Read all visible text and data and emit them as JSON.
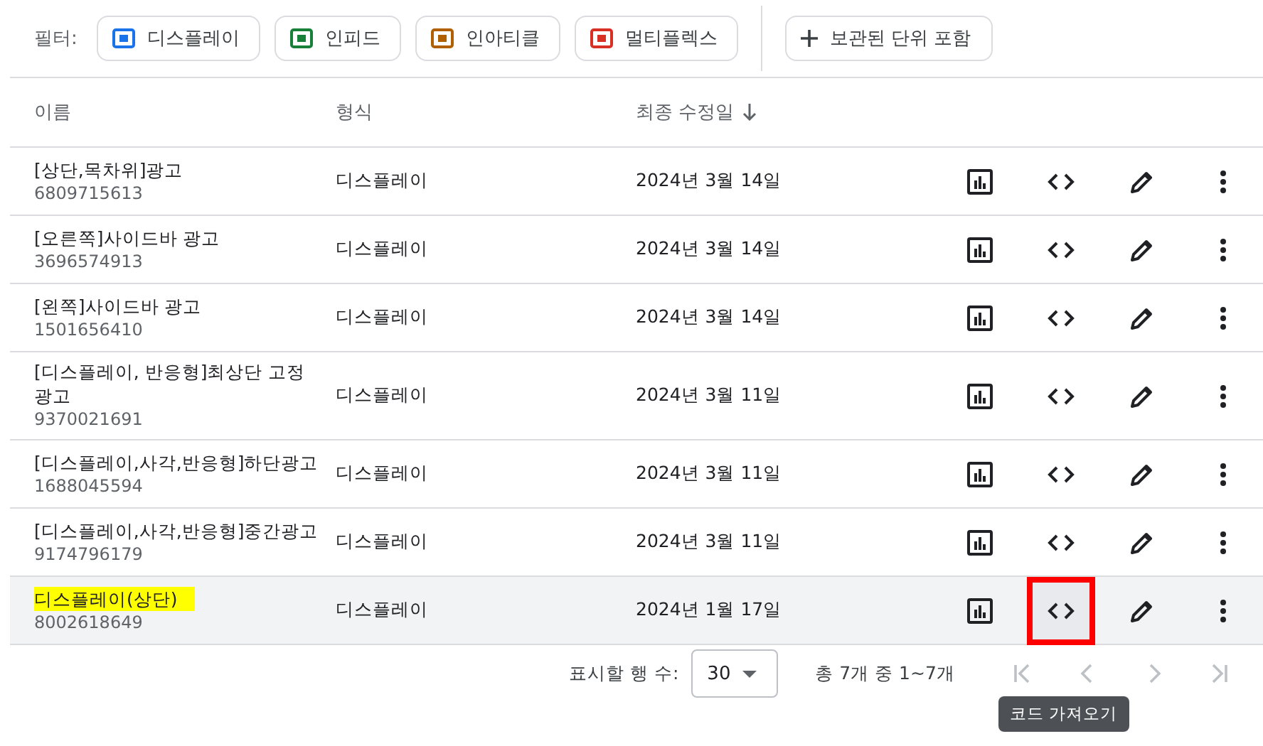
{
  "filter_bar": {
    "label": "필터:",
    "chips": [
      {
        "label": "디스플레이",
        "color": "#1a73e8"
      },
      {
        "label": "인피드",
        "color": "#188038"
      },
      {
        "label": "인아티클",
        "color": "#b06000"
      },
      {
        "label": "멀티플렉스",
        "color": "#d93025"
      }
    ],
    "archived_button": "보관된 단위 포함"
  },
  "table": {
    "columns": [
      "이름",
      "형식",
      "최종 수정일"
    ],
    "rows": [
      {
        "name": "[상단,목차위]광고",
        "id": "6809715613",
        "format": "디스플레이",
        "modified": "2024년 3월 14일",
        "highlighted": false,
        "hovered": false,
        "marked": false
      },
      {
        "name": "[오른쪽]사이드바 광고",
        "id": "3696574913",
        "format": "디스플레이",
        "modified": "2024년 3월 14일",
        "highlighted": false,
        "hovered": false,
        "marked": false
      },
      {
        "name": "[왼쪽]사이드바 광고",
        "id": "1501656410",
        "format": "디스플레이",
        "modified": "2024년 3월 14일",
        "highlighted": false,
        "hovered": false,
        "marked": false
      },
      {
        "name": "[디스플레이, 반응형]최상단 고정광고",
        "id": "9370021691",
        "format": "디스플레이",
        "modified": "2024년 3월 11일",
        "highlighted": false,
        "hovered": false,
        "marked": false
      },
      {
        "name": "[디스플레이,사각,반응형]하단광고",
        "id": "1688045594",
        "format": "디스플레이",
        "modified": "2024년 3월 11일",
        "highlighted": false,
        "hovered": false,
        "marked": false
      },
      {
        "name": "[디스플레이,사각,반응형]중간광고",
        "id": "9174796179",
        "format": "디스플레이",
        "modified": "2024년 3월 11일",
        "highlighted": false,
        "hovered": false,
        "marked": false
      },
      {
        "name": "디스플레이(상단)",
        "id": "8002618649",
        "format": "디스플레이",
        "modified": "2024년 1월 17일",
        "highlighted": true,
        "hovered": true,
        "marked": true
      }
    ]
  },
  "footer": {
    "rows_label": "표시할 행 수:",
    "rows_value": "30",
    "range": "총 7개 중 1~7개",
    "tooltip": "코드 가져오기"
  }
}
